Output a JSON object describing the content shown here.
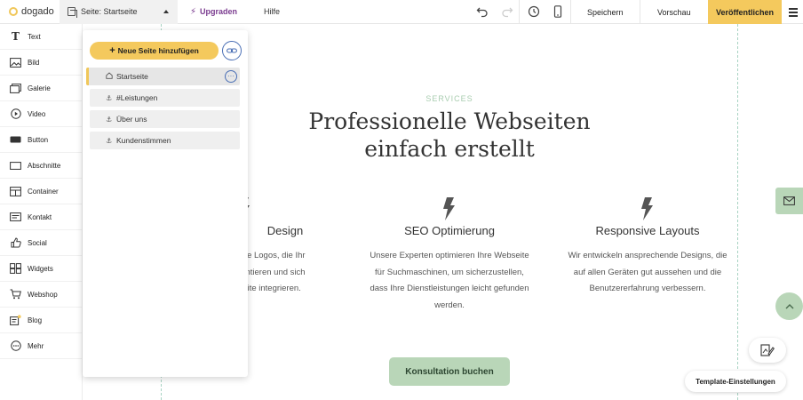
{
  "topbar": {
    "logo_text": "dogado",
    "page_label": "Seite: Startseite",
    "upgrade_label": "Upgraden",
    "help_label": "Hilfe",
    "save_label": "Speichern",
    "preview_label": "Vorschau",
    "publish_label": "Veröffentlichen",
    "icons": [
      "undo-icon",
      "redo-icon",
      "history-icon",
      "mobile-preview-icon",
      "hamburger-menu-icon"
    ]
  },
  "sidebar": {
    "items": [
      {
        "label": "Text",
        "icon": "text-icon"
      },
      {
        "label": "Bild",
        "icon": "image-icon"
      },
      {
        "label": "Galerie",
        "icon": "gallery-icon"
      },
      {
        "label": "Video",
        "icon": "video-icon"
      },
      {
        "label": "Button",
        "icon": "button-icon"
      },
      {
        "label": "Abschnitte",
        "icon": "section-icon"
      },
      {
        "label": "Container",
        "icon": "container-icon"
      },
      {
        "label": "Kontakt",
        "icon": "contact-icon"
      },
      {
        "label": "Social",
        "icon": "social-icon"
      },
      {
        "label": "Widgets",
        "icon": "widgets-icon"
      },
      {
        "label": "Webshop",
        "icon": "cart-icon"
      },
      {
        "label": "Blog",
        "icon": "blog-icon"
      },
      {
        "label": "Mehr",
        "icon": "more-icon"
      }
    ]
  },
  "pages_panel": {
    "add_page_label": "Neue Seite hinzufügen",
    "pages": [
      {
        "label": "Startseite",
        "icon": "home-icon",
        "active": true
      },
      {
        "label": "#Leistungen",
        "icon": "anchor-icon",
        "active": false
      },
      {
        "label": "Über uns",
        "icon": "anchor-icon",
        "active": false
      },
      {
        "label": "Kundenstimmen",
        "icon": "anchor-icon",
        "active": false
      }
    ]
  },
  "content": {
    "services_label": "SERVICES",
    "headline_line1": "Professionelle Webseiten",
    "headline_line2": "einfach erstellt",
    "features": [
      {
        "title": "Design",
        "text": [
          "duelle Logos, die Ihr",
          "räsentieren und sich",
          "ebseite integrieren."
        ]
      },
      {
        "title": "SEO Optimierung",
        "text": [
          "Unsere Experten optimieren Ihre Webseite",
          "für Suchmaschinen, um sicherzustellen,",
          "dass Ihre Dienstleistungen leicht gefunden",
          "werden."
        ]
      },
      {
        "title": "Responsive Layouts",
        "text": [
          "Wir entwickeln ansprechende Designs, die",
          "auf allen Geräten gut aussehen und die",
          "Benutzererfahrung verbessern."
        ]
      }
    ],
    "cta_label": "Konsultation buchen",
    "template_settings_label": "Template-Einstellungen"
  },
  "colors": {
    "accent": "#f4c95d",
    "brand_green": "#b9d6b8",
    "upgrade_purple": "#7a3b8f",
    "link_blue": "#4a6fb5"
  }
}
